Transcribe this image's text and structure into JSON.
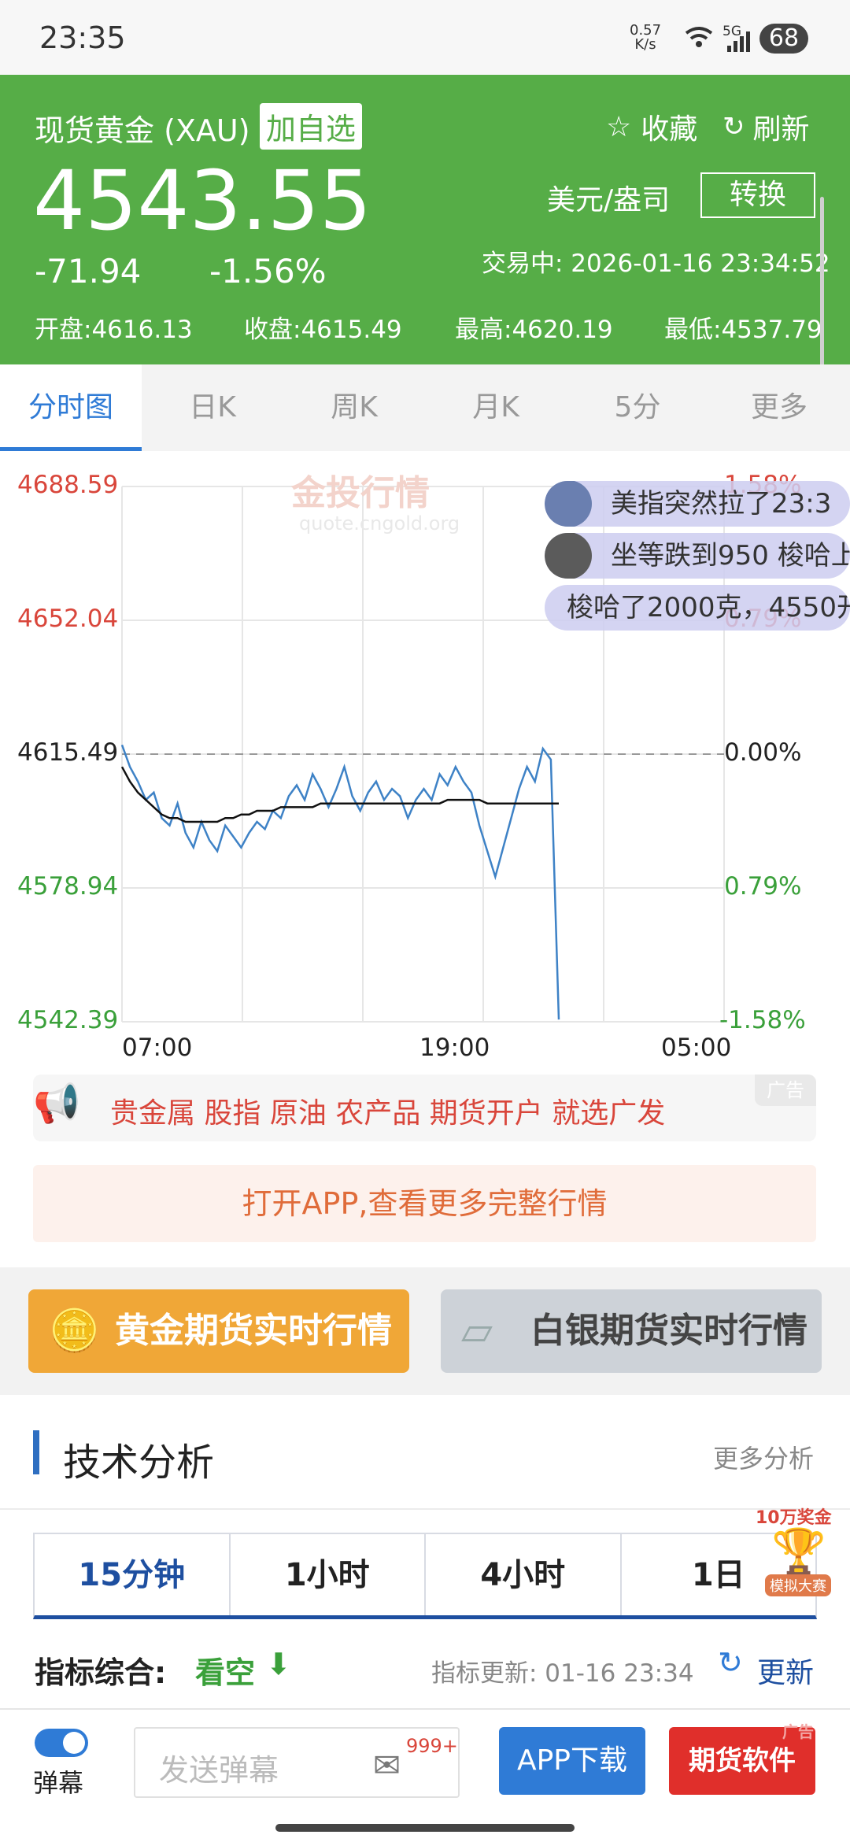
{
  "statusbar": {
    "time": "23:35",
    "net_speed_top": "0.57",
    "net_speed_bottom": "K/s",
    "signal": "5G",
    "battery": "68"
  },
  "header": {
    "title": "现货黄金 (XAU)",
    "add_watch": "加自选",
    "favorite": "收藏",
    "refresh": "刷新",
    "price": "4543.55",
    "unit": "美元/盎司",
    "convert": "转换",
    "change": "-71.94",
    "change_pct": "-1.56%",
    "trade_status": "交易中: 2026-01-16 23:34:52",
    "open": "开盘:4616.13",
    "close": "收盘:4615.49",
    "high": "最高:4620.19",
    "low": "最低:4537.79"
  },
  "tabs": [
    "分时图",
    "日K",
    "周K",
    "月K",
    "5分",
    "更多"
  ],
  "watermark": {
    "text": "金投行情",
    "url": "quote.cngold.org"
  },
  "danmaku": [
    {
      "text": "美指突然拉了23:3"
    },
    {
      "text": "坐等跌到950 梭哈上"
    },
    {
      "text": "梭哈了2000克，4550开"
    }
  ],
  "chart_data": {
    "type": "line",
    "y_left_labels": [
      "4688.59",
      "4652.04",
      "4615.49",
      "4578.94",
      "4542.39"
    ],
    "y_right_labels": [
      "1.58%",
      "0.79%",
      "0.00%",
      "0.79%",
      "-1.58%"
    ],
    "x_labels": [
      "07:00",
      "19:00",
      "05:00"
    ],
    "ylim": [
      4542.39,
      4688.59
    ],
    "reference": 4615.49,
    "series": [
      {
        "values": [
          4618,
          4612,
          4608,
          4603,
          4605,
          4598,
          4596,
          4602,
          4594,
          4590,
          4597,
          4592,
          4589,
          4596,
          4593,
          4590,
          4594,
          4597,
          4595,
          4600,
          4598,
          4604,
          4607,
          4603,
          4610,
          4606,
          4601,
          4606,
          4612,
          4604,
          4600,
          4605,
          4608,
          4603,
          4606,
          4604,
          4598,
          4603,
          4606,
          4603,
          4610,
          4607,
          4612,
          4608,
          4605,
          4596,
          4589,
          4582,
          4590,
          4598,
          4606,
          4612,
          4608,
          4617,
          4614,
          4543
        ]
      },
      {
        "values": [
          4612,
          4608,
          4605,
          4603,
          4601,
          4599,
          4598,
          4598,
          4597,
          4597,
          4597,
          4597,
          4597,
          4598,
          4598,
          4599,
          4599,
          4600,
          4600,
          4600,
          4601,
          4601,
          4601,
          4601,
          4601,
          4602,
          4602,
          4602,
          4602,
          4602,
          4602,
          4602,
          4602,
          4602,
          4602,
          4602,
          4602,
          4602,
          4602,
          4602,
          4602,
          4603,
          4603,
          4603,
          4603,
          4603,
          4602,
          4602,
          4602,
          4602,
          4602,
          4602,
          4602,
          4602,
          4602,
          4602
        ]
      }
    ]
  },
  "ad_banner": {
    "text": "贵金属 股指 原油 农产品 期货开户 就选广发",
    "badge": "广告"
  },
  "open_app": "打开APP,查看更多完整行情",
  "gold_btn": "黄金期货实时行情",
  "silver_btn": "白银期货实时行情",
  "tech": {
    "title": "技术分析",
    "more": "更多分析",
    "tabs": [
      "15分钟",
      "1小时",
      "4小时",
      "1日"
    ],
    "summary_label": "指标综合:",
    "summary_value": "看空",
    "update_label": "指标更新: 01-16 23:34",
    "update_btn": "更新"
  },
  "prize": {
    "title": "10万奖金",
    "sub": "模拟大赛"
  },
  "bottom": {
    "danmaku_toggle": "弹幕",
    "send_placeholder": "发送弹幕",
    "badge_count": "999+",
    "app_download": "APP下载",
    "futures_soft": "期货软件",
    "ad": "广告"
  },
  "colors": {
    "green": "#56ad47",
    "red": "#d9463b",
    "blue": "#2f7bd6",
    "line": "#3e82c6"
  }
}
